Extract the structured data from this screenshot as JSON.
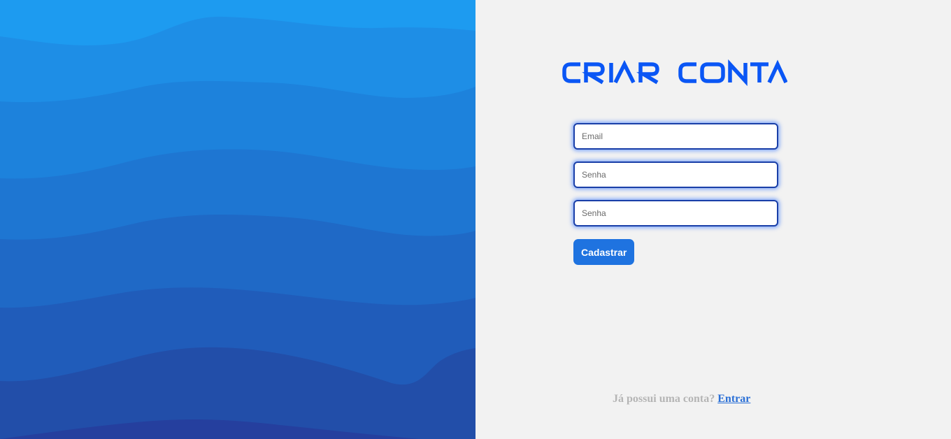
{
  "title": "CRIAR CONTA",
  "form": {
    "email_placeholder": "Email",
    "password_placeholder": "Senha",
    "confirm_password_placeholder": "Senha",
    "submit_label": "Cadastrar"
  },
  "footer": {
    "text": "Já possui uma conta?",
    "link_label": "Entrar"
  },
  "colors": {
    "title": "#0a56f5",
    "button": "#1f73e0",
    "link": "#2a6fd6",
    "right_background": "#f2f2f2",
    "wave_top": "#1e9df2",
    "wave_bottom": "#23389a"
  }
}
